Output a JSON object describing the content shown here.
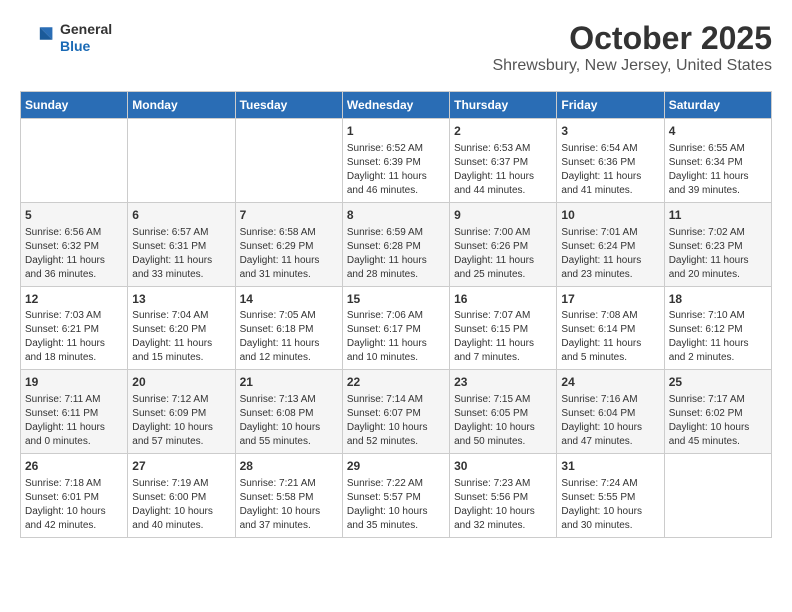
{
  "header": {
    "logo": {
      "general": "General",
      "blue": "Blue"
    },
    "title": "October 2025",
    "subtitle": "Shrewsbury, New Jersey, United States"
  },
  "days_of_week": [
    "Sunday",
    "Monday",
    "Tuesday",
    "Wednesday",
    "Thursday",
    "Friday",
    "Saturday"
  ],
  "weeks": [
    [
      {
        "day": "",
        "info": ""
      },
      {
        "day": "",
        "info": ""
      },
      {
        "day": "",
        "info": ""
      },
      {
        "day": "1",
        "info": "Sunrise: 6:52 AM\nSunset: 6:39 PM\nDaylight: 11 hours and 46 minutes."
      },
      {
        "day": "2",
        "info": "Sunrise: 6:53 AM\nSunset: 6:37 PM\nDaylight: 11 hours and 44 minutes."
      },
      {
        "day": "3",
        "info": "Sunrise: 6:54 AM\nSunset: 6:36 PM\nDaylight: 11 hours and 41 minutes."
      },
      {
        "day": "4",
        "info": "Sunrise: 6:55 AM\nSunset: 6:34 PM\nDaylight: 11 hours and 39 minutes."
      }
    ],
    [
      {
        "day": "5",
        "info": "Sunrise: 6:56 AM\nSunset: 6:32 PM\nDaylight: 11 hours and 36 minutes."
      },
      {
        "day": "6",
        "info": "Sunrise: 6:57 AM\nSunset: 6:31 PM\nDaylight: 11 hours and 33 minutes."
      },
      {
        "day": "7",
        "info": "Sunrise: 6:58 AM\nSunset: 6:29 PM\nDaylight: 11 hours and 31 minutes."
      },
      {
        "day": "8",
        "info": "Sunrise: 6:59 AM\nSunset: 6:28 PM\nDaylight: 11 hours and 28 minutes."
      },
      {
        "day": "9",
        "info": "Sunrise: 7:00 AM\nSunset: 6:26 PM\nDaylight: 11 hours and 25 minutes."
      },
      {
        "day": "10",
        "info": "Sunrise: 7:01 AM\nSunset: 6:24 PM\nDaylight: 11 hours and 23 minutes."
      },
      {
        "day": "11",
        "info": "Sunrise: 7:02 AM\nSunset: 6:23 PM\nDaylight: 11 hours and 20 minutes."
      }
    ],
    [
      {
        "day": "12",
        "info": "Sunrise: 7:03 AM\nSunset: 6:21 PM\nDaylight: 11 hours and 18 minutes."
      },
      {
        "day": "13",
        "info": "Sunrise: 7:04 AM\nSunset: 6:20 PM\nDaylight: 11 hours and 15 minutes."
      },
      {
        "day": "14",
        "info": "Sunrise: 7:05 AM\nSunset: 6:18 PM\nDaylight: 11 hours and 12 minutes."
      },
      {
        "day": "15",
        "info": "Sunrise: 7:06 AM\nSunset: 6:17 PM\nDaylight: 11 hours and 10 minutes."
      },
      {
        "day": "16",
        "info": "Sunrise: 7:07 AM\nSunset: 6:15 PM\nDaylight: 11 hours and 7 minutes."
      },
      {
        "day": "17",
        "info": "Sunrise: 7:08 AM\nSunset: 6:14 PM\nDaylight: 11 hours and 5 minutes."
      },
      {
        "day": "18",
        "info": "Sunrise: 7:10 AM\nSunset: 6:12 PM\nDaylight: 11 hours and 2 minutes."
      }
    ],
    [
      {
        "day": "19",
        "info": "Sunrise: 7:11 AM\nSunset: 6:11 PM\nDaylight: 11 hours and 0 minutes."
      },
      {
        "day": "20",
        "info": "Sunrise: 7:12 AM\nSunset: 6:09 PM\nDaylight: 10 hours and 57 minutes."
      },
      {
        "day": "21",
        "info": "Sunrise: 7:13 AM\nSunset: 6:08 PM\nDaylight: 10 hours and 55 minutes."
      },
      {
        "day": "22",
        "info": "Sunrise: 7:14 AM\nSunset: 6:07 PM\nDaylight: 10 hours and 52 minutes."
      },
      {
        "day": "23",
        "info": "Sunrise: 7:15 AM\nSunset: 6:05 PM\nDaylight: 10 hours and 50 minutes."
      },
      {
        "day": "24",
        "info": "Sunrise: 7:16 AM\nSunset: 6:04 PM\nDaylight: 10 hours and 47 minutes."
      },
      {
        "day": "25",
        "info": "Sunrise: 7:17 AM\nSunset: 6:02 PM\nDaylight: 10 hours and 45 minutes."
      }
    ],
    [
      {
        "day": "26",
        "info": "Sunrise: 7:18 AM\nSunset: 6:01 PM\nDaylight: 10 hours and 42 minutes."
      },
      {
        "day": "27",
        "info": "Sunrise: 7:19 AM\nSunset: 6:00 PM\nDaylight: 10 hours and 40 minutes."
      },
      {
        "day": "28",
        "info": "Sunrise: 7:21 AM\nSunset: 5:58 PM\nDaylight: 10 hours and 37 minutes."
      },
      {
        "day": "29",
        "info": "Sunrise: 7:22 AM\nSunset: 5:57 PM\nDaylight: 10 hours and 35 minutes."
      },
      {
        "day": "30",
        "info": "Sunrise: 7:23 AM\nSunset: 5:56 PM\nDaylight: 10 hours and 32 minutes."
      },
      {
        "day": "31",
        "info": "Sunrise: 7:24 AM\nSunset: 5:55 PM\nDaylight: 10 hours and 30 minutes."
      },
      {
        "day": "",
        "info": ""
      }
    ]
  ]
}
